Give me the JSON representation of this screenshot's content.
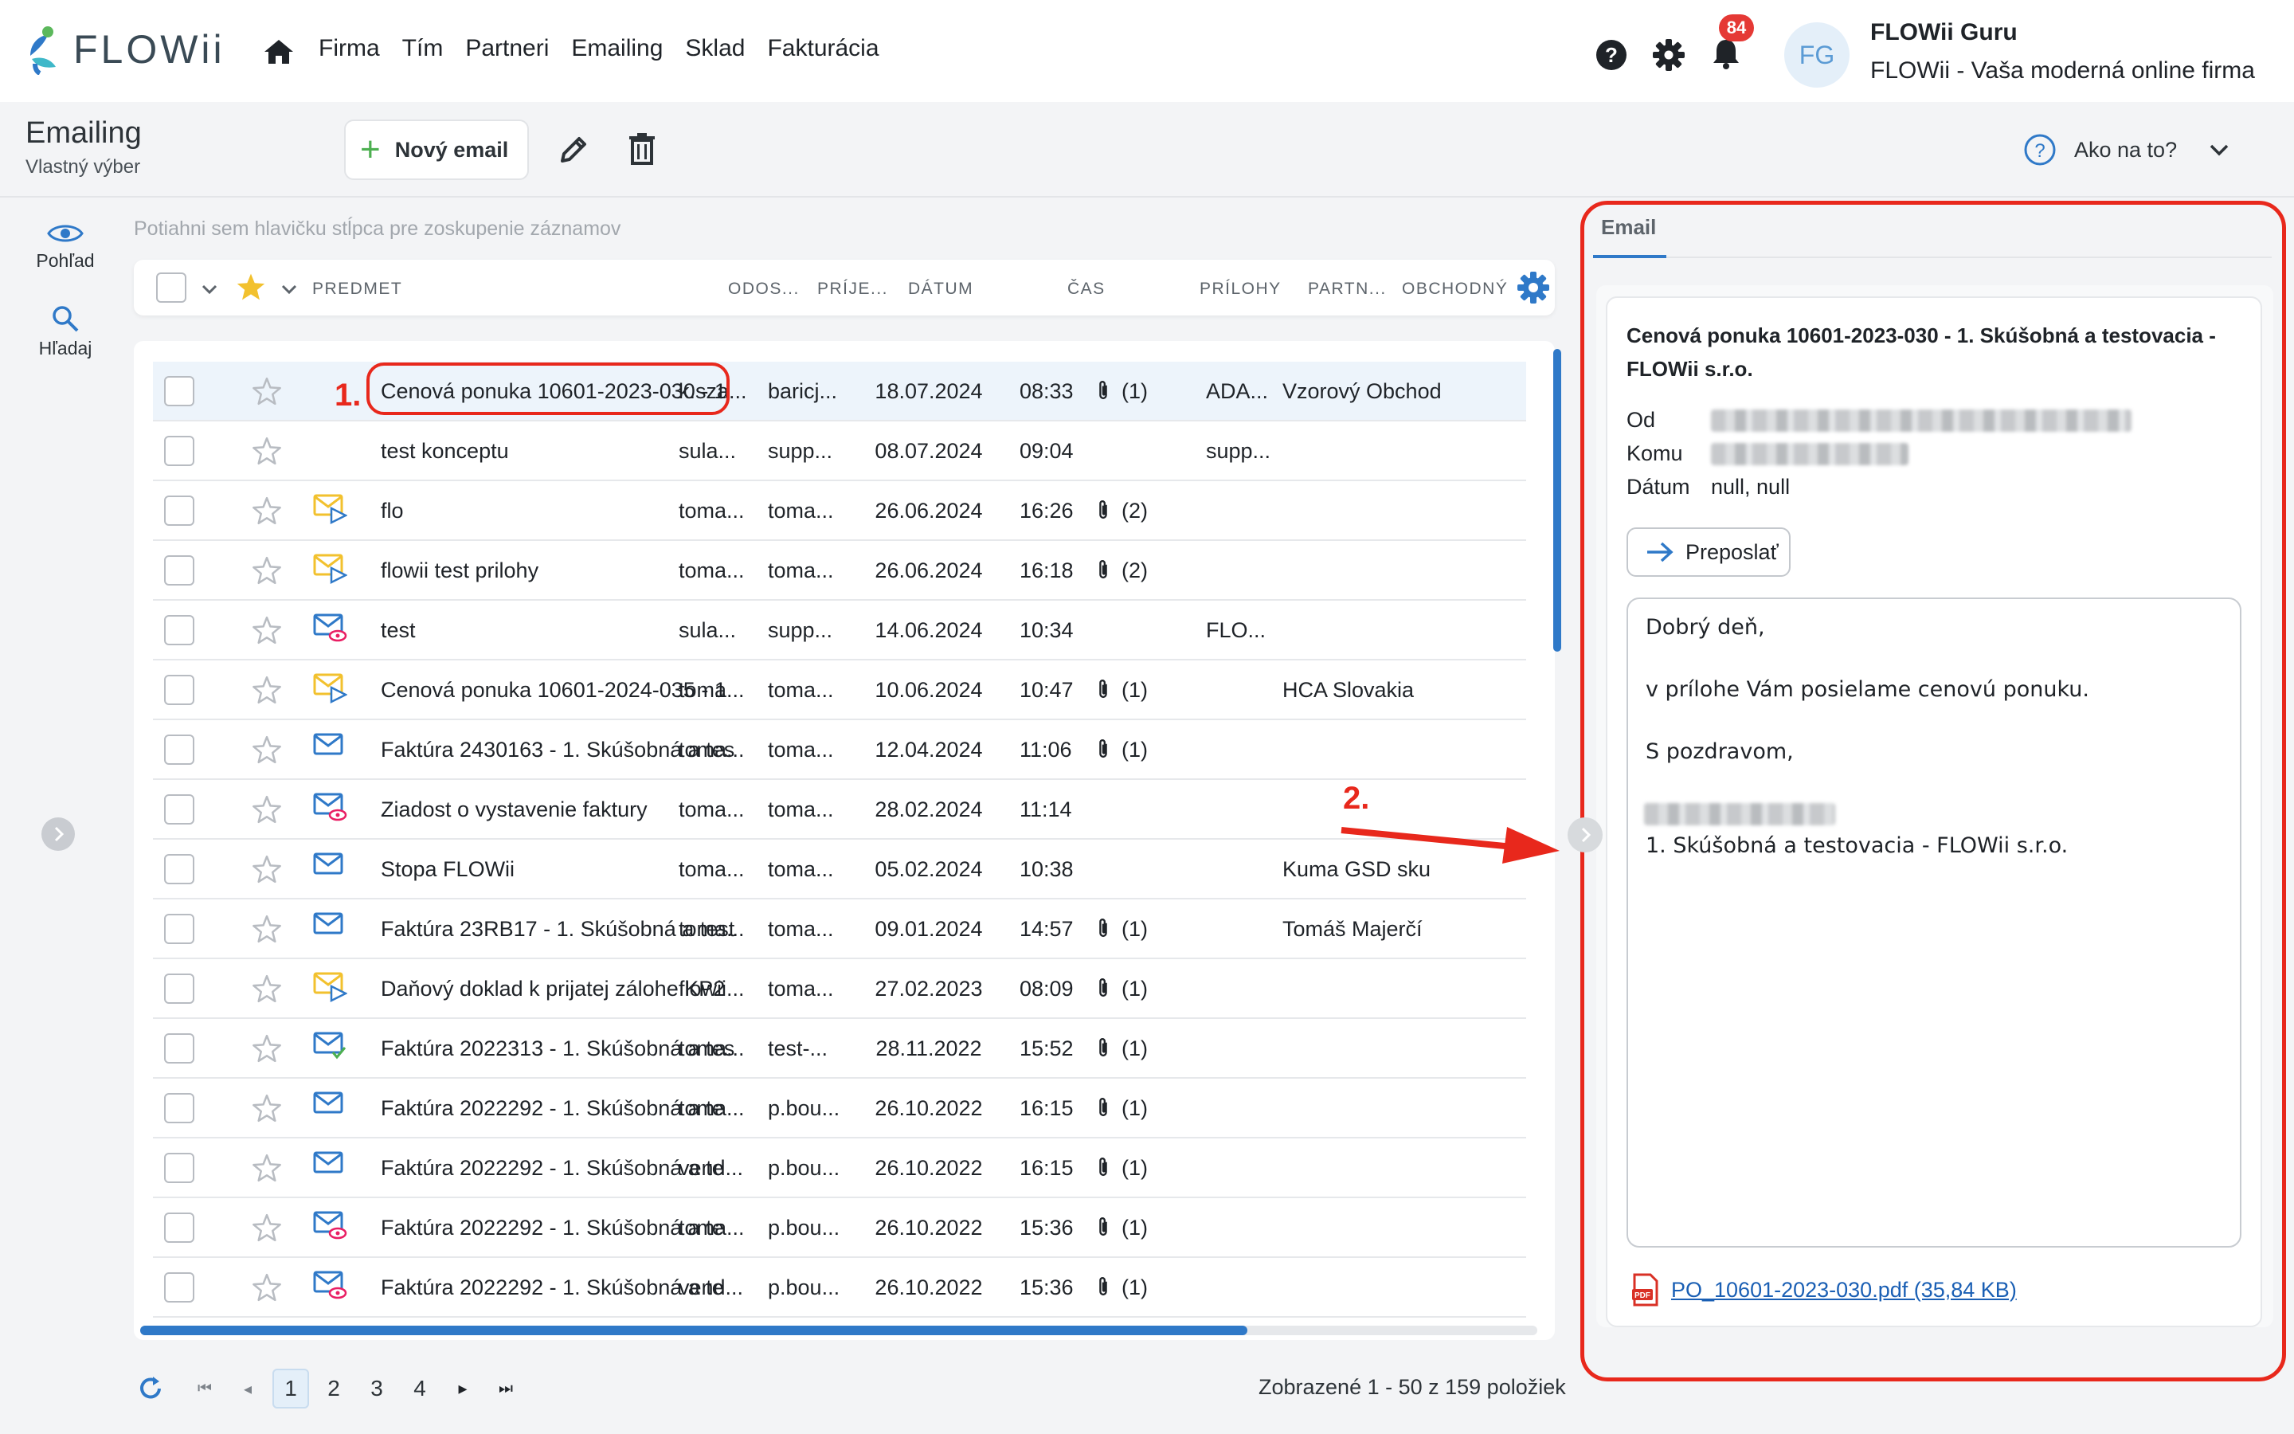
{
  "app": {
    "logo_text": "FLOWii",
    "nav": [
      "Firma",
      "Tím",
      "Partneri",
      "Emailing",
      "Sklad",
      "Fakturácia"
    ],
    "notifications_count": "84",
    "avatar_initials": "FG",
    "user_name": "FLOWii Guru",
    "user_company": "FLOWii - Vaša moderná online firma"
  },
  "toolbar": {
    "title": "Emailing",
    "subtitle": "Vlastný výber",
    "new_email_label": "Nový email",
    "help_label": "Ako na to?"
  },
  "sidebar": {
    "view_label": "Pohľad",
    "search_label": "Hľadaj"
  },
  "grid": {
    "group_hint": "Potiahni sem hlavičku stĺpca pre zoskupenie záznamov",
    "columns": {
      "subject": "PREDMET",
      "sender": "ODOS...",
      "recipient": "PRÍJE...",
      "date": "DÁTUM",
      "time": "ČAS",
      "attachments": "PRÍLOHY",
      "partner": "PARTN...",
      "business": "OBCHODNÝ"
    },
    "rows": [
      {
        "subject": "Cenová ponuka 10601-2023-030 - 1",
        "sender": "k.sza...",
        "recipient": "baricj...",
        "date": "18.07.2024",
        "time": "08:33",
        "attachments": "(1)",
        "partner": "ADA...",
        "business": "Vzorový Obchod",
        "icon": "none",
        "selected": true
      },
      {
        "subject": "test konceptu",
        "sender": "sula...",
        "recipient": "supp...",
        "date": "08.07.2024",
        "time": "09:04",
        "attachments": "",
        "partner": "supp...",
        "business": "",
        "icon": "none"
      },
      {
        "subject": "flo",
        "sender": "toma...",
        "recipient": "toma...",
        "date": "26.06.2024",
        "time": "16:26",
        "attachments": "(2)",
        "partner": "",
        "business": "",
        "icon": "sent"
      },
      {
        "subject": "flowii test prilohy",
        "sender": "toma...",
        "recipient": "toma...",
        "date": "26.06.2024",
        "time": "16:18",
        "attachments": "(2)",
        "partner": "",
        "business": "",
        "icon": "sent"
      },
      {
        "subject": "test",
        "sender": "sula...",
        "recipient": "supp...",
        "date": "14.06.2024",
        "time": "10:34",
        "attachments": "",
        "partner": "FLO...",
        "business": "",
        "icon": "opened"
      },
      {
        "subject": "Cenová ponuka 10601-2024-035 - 1",
        "sender": "toma...",
        "recipient": "toma...",
        "date": "10.06.2024",
        "time": "10:47",
        "attachments": "(1)",
        "partner": "",
        "business": "HCA Slovakia",
        "icon": "sent"
      },
      {
        "subject": "Faktúra 2430163 - 1. Skúšobná a tes",
        "sender": "toma...",
        "recipient": "toma...",
        "date": "12.04.2024",
        "time": "11:06",
        "attachments": "(1)",
        "partner": "",
        "business": "",
        "icon": "mail"
      },
      {
        "subject": "Ziadost o vystavenie faktury",
        "sender": "toma...",
        "recipient": "toma...",
        "date": "28.02.2024",
        "time": "11:14",
        "attachments": "",
        "partner": "",
        "business": "",
        "icon": "opened"
      },
      {
        "subject": "Stopa FLOWii",
        "sender": "toma...",
        "recipient": "toma...",
        "date": "05.02.2024",
        "time": "10:38",
        "attachments": "",
        "partner": "",
        "business": "Kuma GSD sku",
        "icon": "mail"
      },
      {
        "subject": "Faktúra 23RB17 - 1. Skúšobná a test",
        "sender": "toma...",
        "recipient": "toma...",
        "date": "09.01.2024",
        "time": "14:57",
        "attachments": "(1)",
        "partner": "",
        "business": "Tomáš Majerčí",
        "icon": "mail"
      },
      {
        "subject": "Daňový doklad k prijatej zálohe KP2",
        "sender": "flowii...",
        "recipient": "toma...",
        "date": "27.02.2023",
        "time": "08:09",
        "attachments": "(1)",
        "partner": "",
        "business": "",
        "icon": "sent"
      },
      {
        "subject": "Faktúra 2022313 - 1. Skúšobná a tes",
        "sender": "toma...",
        "recipient": "test-...",
        "date": "28.11.2022",
        "time": "15:52",
        "attachments": "(1)",
        "partner": "",
        "business": "",
        "icon": "delivered"
      },
      {
        "subject": "Faktúra 2022292 - 1. Skúšobná a te",
        "sender": "toma...",
        "recipient": "p.bou...",
        "date": "26.10.2022",
        "time": "16:15",
        "attachments": "(1)",
        "partner": "",
        "business": "",
        "icon": "mail"
      },
      {
        "subject": "Faktúra 2022292 - 1. Skúšobná a te",
        "sender": "vend...",
        "recipient": "p.bou...",
        "date": "26.10.2022",
        "time": "16:15",
        "attachments": "(1)",
        "partner": "",
        "business": "",
        "icon": "mail"
      },
      {
        "subject": "Faktúra 2022292 - 1. Skúšobná a te",
        "sender": "toma...",
        "recipient": "p.bou...",
        "date": "26.10.2022",
        "time": "15:36",
        "attachments": "(1)",
        "partner": "",
        "business": "",
        "icon": "opened"
      },
      {
        "subject": "Faktúra 2022292 - 1. Skúšobná a te",
        "sender": "vend...",
        "recipient": "p.bou...",
        "date": "26.10.2022",
        "time": "15:36",
        "attachments": "(1)",
        "partner": "",
        "business": "",
        "icon": "opened"
      }
    ]
  },
  "pagination": {
    "pages": [
      "1",
      "2",
      "3",
      "4"
    ],
    "current": "1",
    "summary": "Zobrazené 1 - 50 z 159 položiek"
  },
  "preview": {
    "tab_label": "Email",
    "subject": "Cenová ponuka 10601-2023-030 - 1. Skúšobná a testovacia - FLOWii s.r.o.",
    "from_label": "Od",
    "to_label": "Komu",
    "date_label": "Dátum",
    "date_value": "null, null",
    "forward_label": "Preposlať",
    "body_lines": [
      "Dobrý deň,",
      "v prílohe Vám posielame cenovú ponuku.",
      "S pozdravom,",
      "1. Skúšobná a testovacia - FLOWii s.r.o."
    ],
    "attachment": "PO_10601-2023-030.pdf (35,84 KB)"
  },
  "annotations": {
    "step1": "1.",
    "step2": "2."
  },
  "colors": {
    "accent": "#2f79c8",
    "annotation": "#e8281c",
    "badge": "#e53935",
    "sent_icon": "#f2c12e",
    "opened_icon": "#e91e63",
    "delivered_icon": "#4caf50"
  }
}
